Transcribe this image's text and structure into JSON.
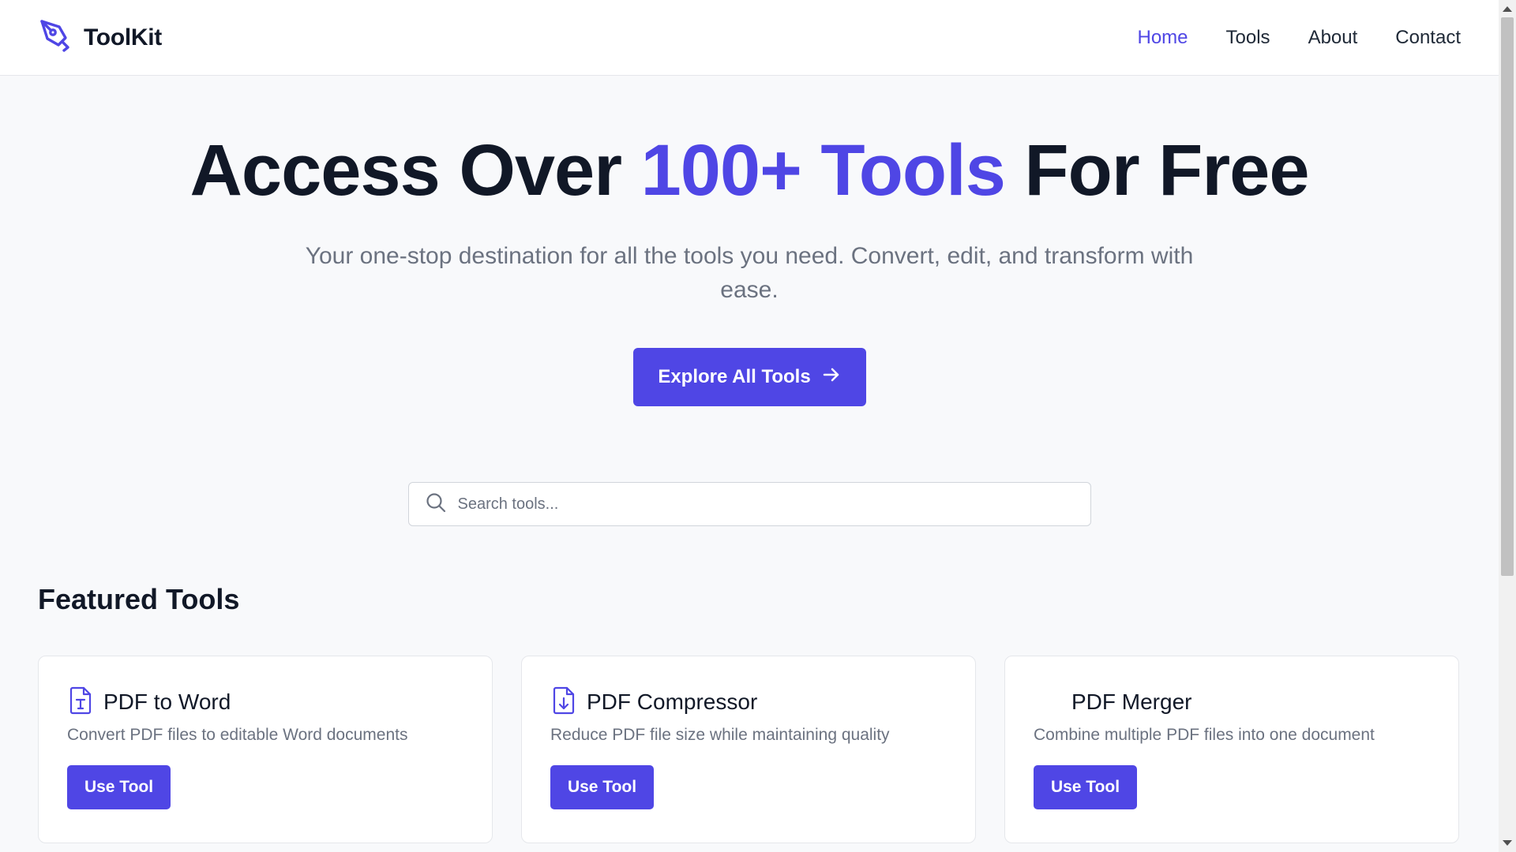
{
  "brand": {
    "name": "ToolKit",
    "logo_icon": "pen-nib-icon",
    "accent_color": "#4f46e5"
  },
  "nav": {
    "items": [
      {
        "label": "Home",
        "active": true
      },
      {
        "label": "Tools",
        "active": false
      },
      {
        "label": "About",
        "active": false
      },
      {
        "label": "Contact",
        "active": false
      }
    ]
  },
  "hero": {
    "title_part1": "Access Over ",
    "title_accent": "100+ Tools",
    "title_part2": " For Free",
    "subtitle": "Your one-stop destination for all the tools you need. Convert, edit, and transform with ease.",
    "cta_label": "Explore All Tools",
    "cta_icon": "arrow-right-icon"
  },
  "search": {
    "placeholder": "Search tools...",
    "value": "",
    "icon": "search-icon"
  },
  "featured": {
    "heading": "Featured Tools",
    "cards": [
      {
        "title": "PDF to Word",
        "description": "Convert PDF files to editable Word documents",
        "button": "Use Tool",
        "icon": "file-text-icon"
      },
      {
        "title": "PDF Compressor",
        "description": "Reduce PDF file size while maintaining quality",
        "button": "Use Tool",
        "icon": "file-download-icon"
      },
      {
        "title": "PDF Merger",
        "description": "Combine multiple PDF files into one document",
        "button": "Use Tool",
        "icon": ""
      }
    ]
  }
}
